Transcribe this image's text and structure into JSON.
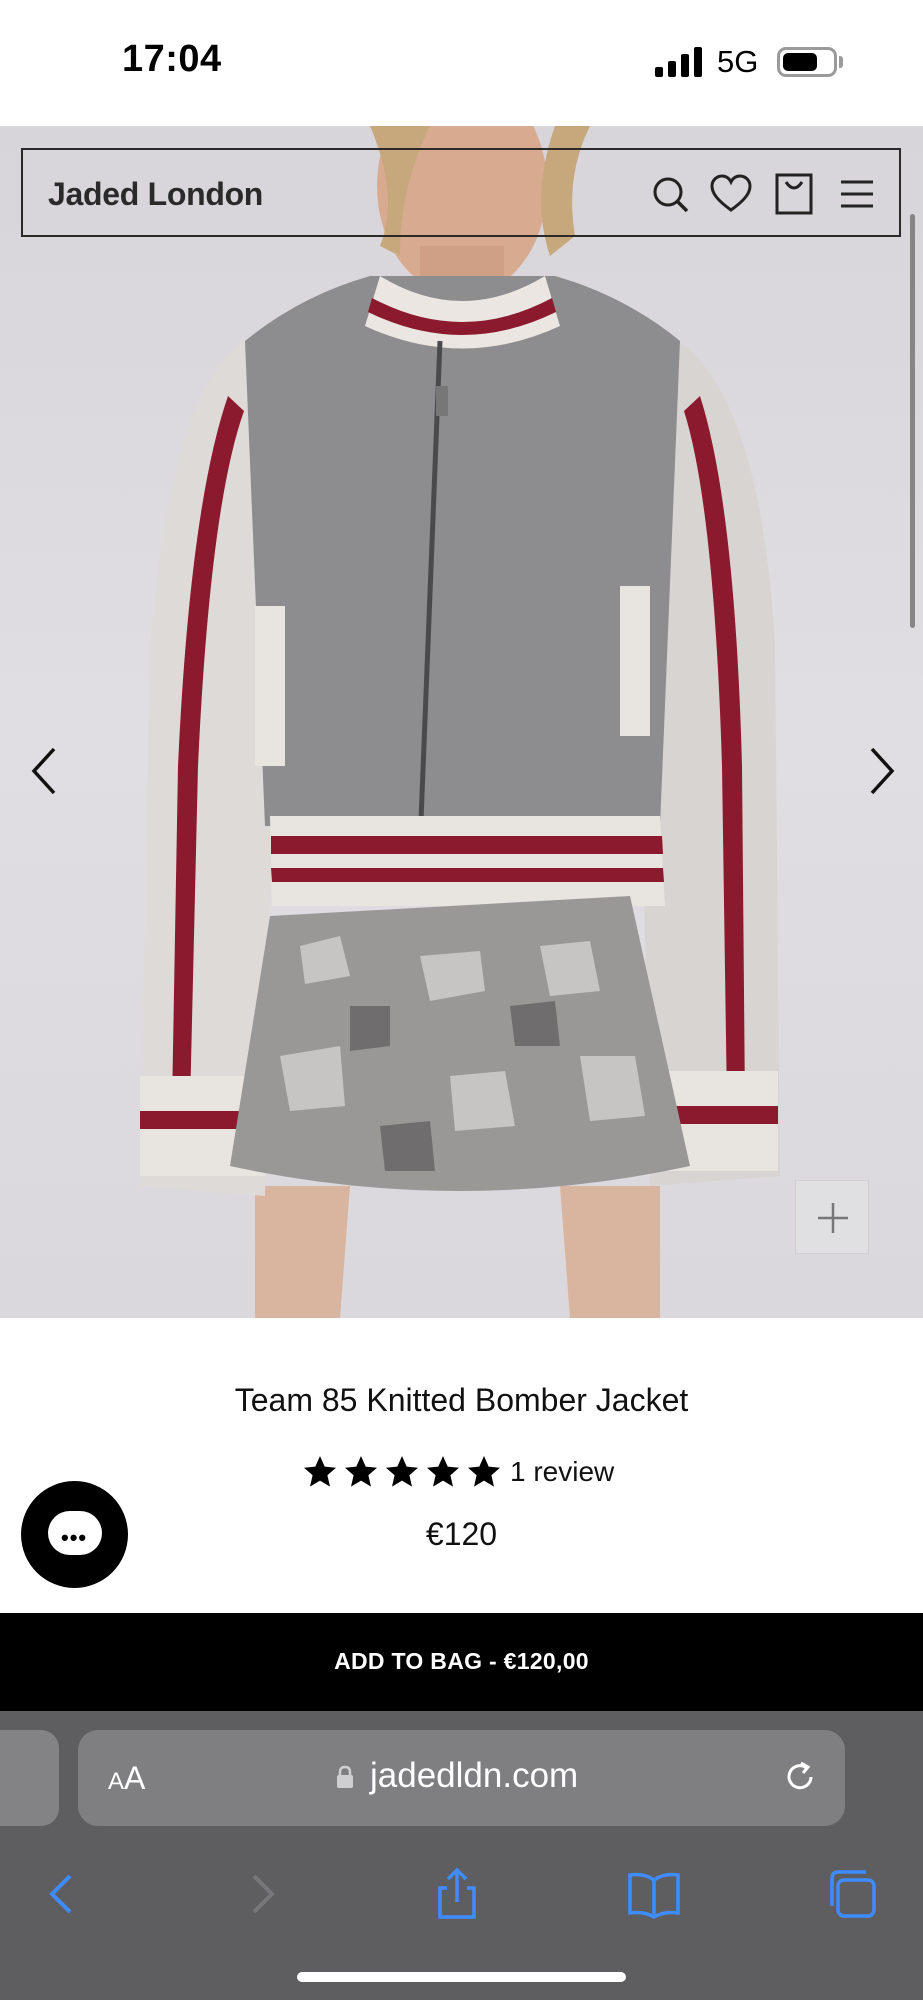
{
  "status_bar": {
    "time": "17:04",
    "network": "5G"
  },
  "header": {
    "brand": "Jaded London"
  },
  "product": {
    "title": "Team 85 Knitted Bomber Jacket",
    "rating_stars": 5,
    "review_text": "1 review",
    "price": "€120"
  },
  "cta": {
    "add_to_bag": "ADD TO BAG - €120,00"
  },
  "browser": {
    "aa_small": "A",
    "aa_big": "A",
    "url": "jadedldn.com"
  },
  "icons": {
    "header": [
      "search-icon",
      "heart-icon",
      "bag-icon",
      "menu-icon"
    ],
    "gallery": [
      "chevron-left-icon",
      "chevron-right-icon",
      "plus-icon"
    ],
    "toolbar": [
      "back-icon",
      "forward-icon",
      "share-icon",
      "bookmarks-icon",
      "tabs-icon"
    ]
  },
  "colors": {
    "cta_background": "#000000",
    "browser_chrome": "#5e5e60",
    "jacket_stripe": "#8b1a2e"
  }
}
